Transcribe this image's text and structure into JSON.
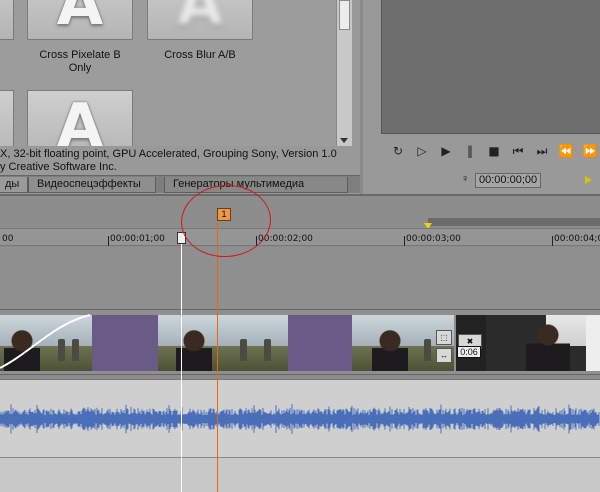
{
  "effects_panel": {
    "thumbnails": [
      {
        "letter": "A",
        "label_line1": "Cross Pixelate B",
        "label_line2": "Only"
      },
      {
        "letter": "A",
        "label_line1": "Cross Blur A/B",
        "label_line2": ""
      },
      {
        "letter": "A",
        "label_line1": "",
        "label_line2": ""
      }
    ],
    "info_line1": "X, 32-bit floating point, GPU Accelerated, Grouping Sony, Version 1.0",
    "info_line2": "y Creative Software Inc.",
    "tabs": [
      {
        "label": "ды"
      },
      {
        "label": "Видеоспецэффекты"
      },
      {
        "label": "Генераторы мультимедиа"
      }
    ]
  },
  "preview": {
    "timecode": "00:00:00;00",
    "transport_icons": [
      "loop-icon",
      "play-from-start-icon",
      "play-icon",
      "pause-icon",
      "stop-icon",
      "prev-frame-icon",
      "next-frame-icon",
      "rewind-icon",
      "forward-icon"
    ]
  },
  "timeline": {
    "ruler_labels": [
      "00",
      "00:00:01;00",
      "00:00:02;00",
      "00:00:03;00",
      "00:00:04;00"
    ],
    "marker_label": "1",
    "clip_time_badge": "0:06"
  },
  "colors": {
    "marker": "#e89a4c",
    "annotation_circle": "#d01818",
    "waveform": "#4a6fb8",
    "transition_purple": "#6a5a86"
  }
}
